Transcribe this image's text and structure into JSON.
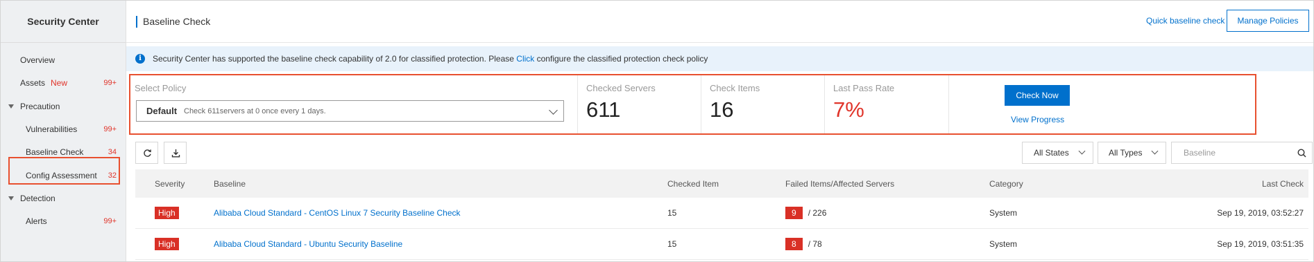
{
  "sidebar": {
    "title": "Security Center",
    "items": [
      {
        "label": "Overview"
      },
      {
        "label": "Assets",
        "badge": "New",
        "count": "99+"
      },
      {
        "label": "Precaution"
      },
      {
        "label": "Vulnerabilities",
        "count": "99+"
      },
      {
        "label": "Baseline Check",
        "count": "34"
      },
      {
        "label": "Config Assessment",
        "count": "32"
      },
      {
        "label": "Detection"
      },
      {
        "label": "Alerts",
        "count": "99+"
      }
    ]
  },
  "header": {
    "title": "Baseline Check",
    "quick_link": "Quick baseline check",
    "manage_button": "Manage Policies"
  },
  "notice": {
    "text_before": "Security Center has supported the baseline check capability of 2.0 for classified protection. Please ",
    "link": "Click",
    "text_after": " configure the classified protection check policy"
  },
  "policy": {
    "select_label": "Select Policy",
    "selected_name": "Default",
    "selected_desc": "Check 611servers at 0 once every 1 days.",
    "stats": [
      {
        "label": "Checked Servers",
        "value": "611"
      },
      {
        "label": "Check Items",
        "value": "16"
      },
      {
        "label": "Last Pass Rate",
        "value": "7%"
      }
    ],
    "check_now": "Check Now",
    "view_progress": "View Progress"
  },
  "toolbar": {
    "filter_states": "All States",
    "filter_types": "All Types",
    "search_placeholder": "Baseline"
  },
  "table": {
    "headers": {
      "severity": "Severity",
      "baseline": "Baseline",
      "checked_item": "Checked Item",
      "failed": "Failed Items/Affected Servers",
      "category": "Category",
      "last_check": "Last Check"
    },
    "rows": [
      {
        "severity": "High",
        "baseline": "Alibaba Cloud Standard - CentOS Linux 7 Security Baseline Check",
        "checked_item": "15",
        "failed": "9",
        "affected": "/ 226",
        "category": "System",
        "last_check": "Sep 19, 2019, 03:52:27"
      },
      {
        "severity": "High",
        "baseline": "Alibaba Cloud Standard - Ubuntu Security Baseline",
        "checked_item": "15",
        "failed": "8",
        "affected": "/ 78",
        "category": "System",
        "last_check": "Sep 19, 2019, 03:51:35"
      }
    ]
  },
  "colors": {
    "primary": "#0070cc",
    "danger": "#d93026",
    "highlight_border": "#e8502f",
    "notice_bg": "#e8f2fb",
    "sidebar_bg": "#eef0f2"
  }
}
